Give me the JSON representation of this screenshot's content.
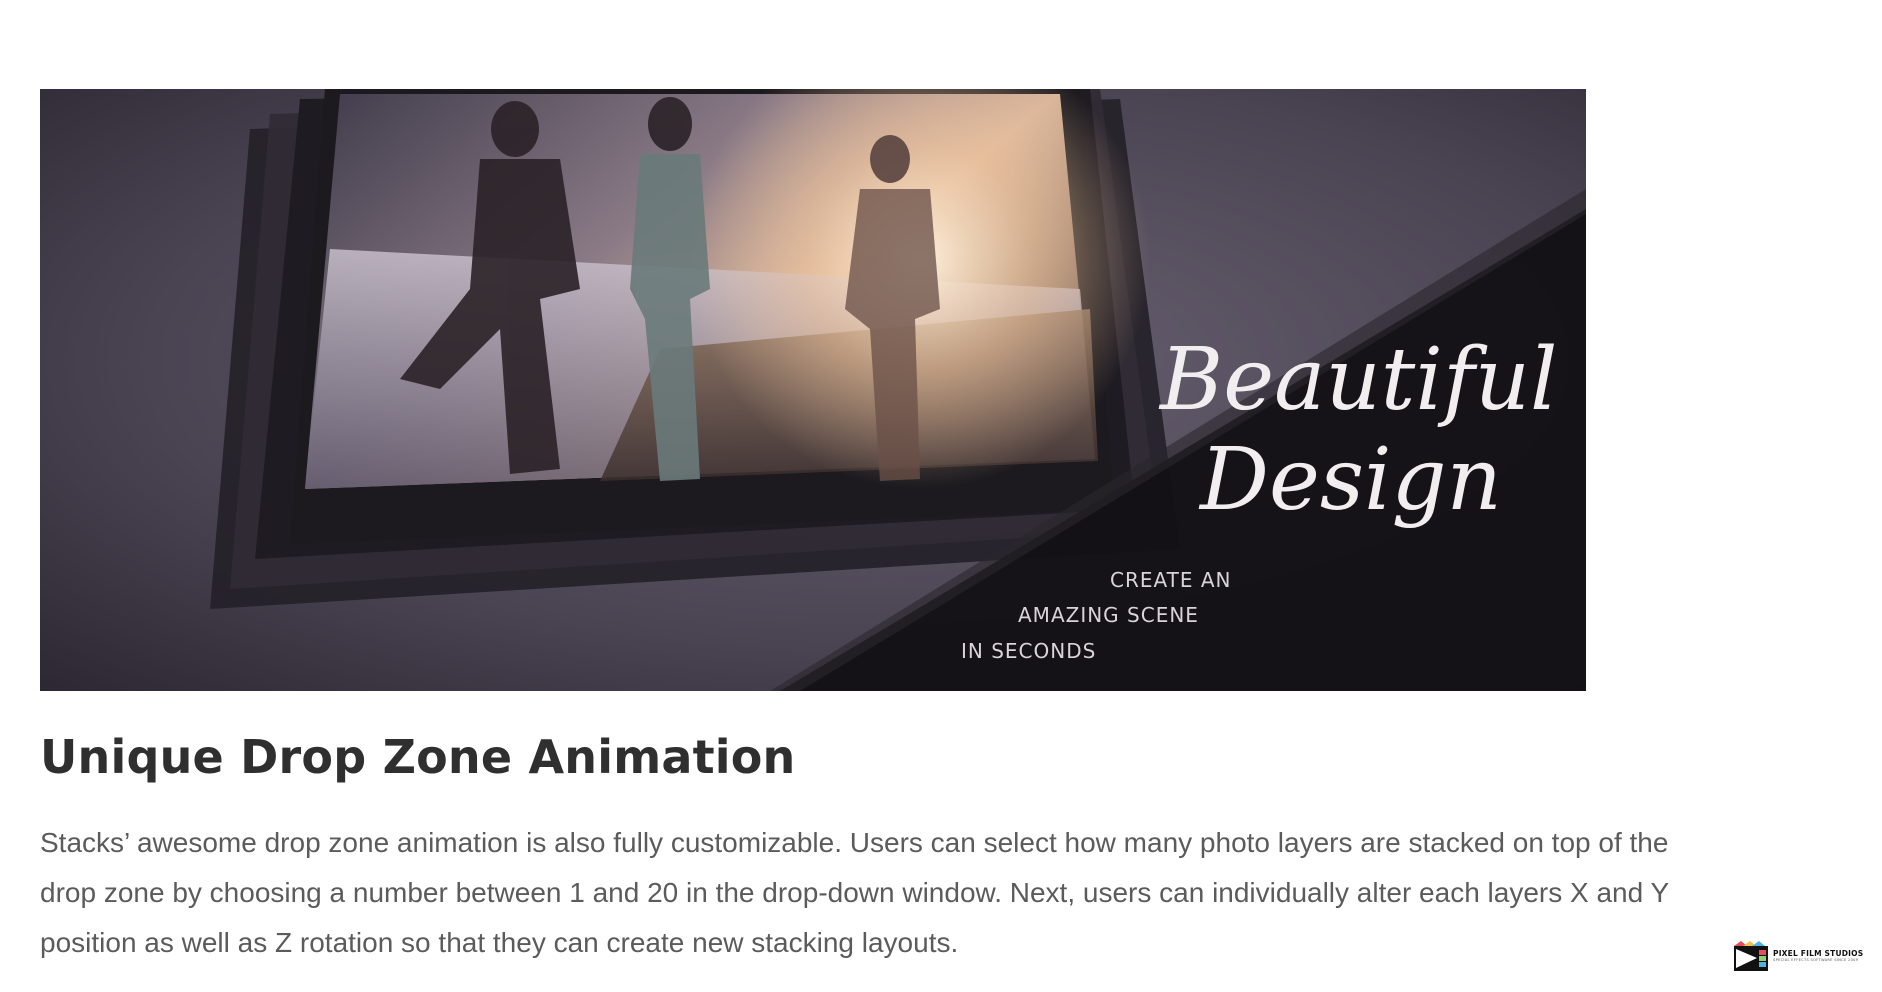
{
  "hero": {
    "script_line1": "Beautiful",
    "script_line2": "Design",
    "caption_line1": "CREATE AN",
    "caption_line2": "AMAZING SCENE",
    "caption_line3": "IN SECONDS"
  },
  "section": {
    "heading": "Unique Drop Zone Animation",
    "body": "Stacks’ awesome drop zone animation is also fully customizable. Users can select how many photo layers are stacked on top of the drop zone by choosing a number between 1 and 20 in the drop-down window. Next, users can individually alter each layers X and Y position as well as Z rotation so that they can create new stacking layouts."
  },
  "logo": {
    "name": "PIXEL FILM STUDIOS",
    "tagline": "SPECIAL EFFECTS SOFTWARE SINCE 2009"
  },
  "colors": {
    "heading": "#2f2f2f",
    "body_text": "#5b5b5b",
    "background": "#ffffff"
  }
}
